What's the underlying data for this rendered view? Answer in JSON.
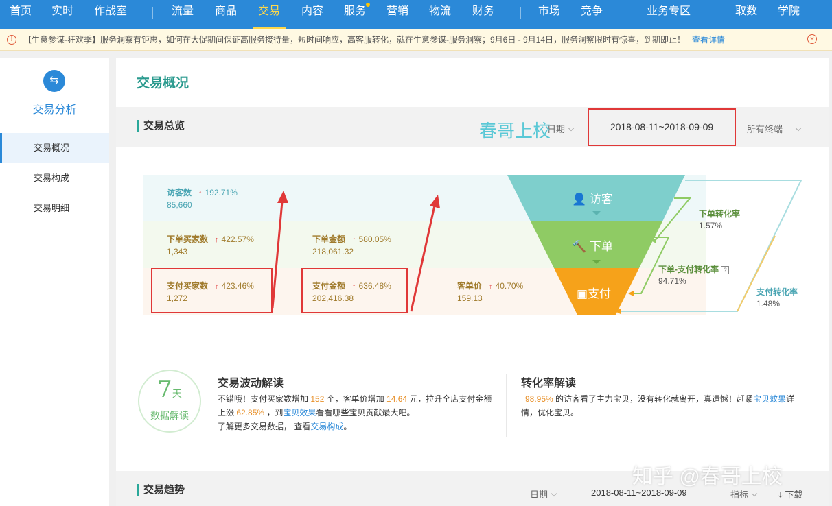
{
  "top_nav": {
    "items": [
      "首页",
      "实时",
      "作战室",
      "流量",
      "商品",
      "交易",
      "内容",
      "服务",
      "营销",
      "物流",
      "财务",
      "市场",
      "竞争",
      "业务专区",
      "取数",
      "学院"
    ],
    "active": "交易",
    "accent_color": "#2b89d8",
    "active_color": "#ffd84a"
  },
  "notice": {
    "icon": "alert-circle-icon",
    "text": "【生意参谋-狂欢季】服务洞察有钜惠，如何在大促期间保证高服务接待量，短时间响应，高客服转化，就在生意参谋-服务洞察；9月6日 - 9月14日，服务洞察限时有惊喜，到期即止！",
    "link": "查看详情",
    "close_icon": "close-circle-icon"
  },
  "sidebar": {
    "logo_icon": "exchange-icon",
    "title": "交易分析",
    "items": [
      "交易概况",
      "交易构成",
      "交易明细"
    ],
    "active": "交易概况"
  },
  "page_title": "交易概况",
  "overview": {
    "title": "交易总览",
    "date_label": "日期",
    "date_range": "2018-08-11~2018-09-09",
    "terminal": "所有终端",
    "watermark": "春哥上校",
    "metrics": {
      "visitors": {
        "label": "访客数",
        "change": "192.71%",
        "value": "85,660"
      },
      "order_buyers": {
        "label": "下单买家数",
        "change": "422.57%",
        "value": "1,343"
      },
      "order_amount": {
        "label": "下单金额",
        "change": "580.05%",
        "value": "218,061.32"
      },
      "pay_buyers": {
        "label": "支付买家数",
        "change": "423.46%",
        "value": "1,272"
      },
      "pay_amount": {
        "label": "支付金额",
        "change": "636.48%",
        "value": "202,416.38"
      },
      "unit_price": {
        "label": "客单价",
        "change": "40.70%",
        "value": "159.13"
      }
    },
    "funnel": {
      "visitor": "访客",
      "order": "下单",
      "pay": "支付",
      "colors": {
        "visitor": "#7ecfcc",
        "order": "#8fcb64",
        "pay": "#f6a21a"
      }
    },
    "rates": {
      "order_rate": {
        "label": "下单转化率",
        "value": "1.57%"
      },
      "order_pay_rate": {
        "label": "下单-支付转化率",
        "value": "94.71%"
      },
      "pay_rate": {
        "label": "支付转化率",
        "value": "1.48%"
      }
    }
  },
  "reading": {
    "circle_number": "7",
    "circle_unit": "天",
    "circle_label": "数据解读",
    "fluctuation": {
      "title": "交易波动解读",
      "t1": "不错哦！支付买家数增加 ",
      "n1": "152",
      "t2": " 个，客单价增加 ",
      "n2": "14.64",
      "t3": " 元，拉升全店支付金额上涨 ",
      "n3": "62.85%",
      "t4": " ，到",
      "link1": "宝贝效果",
      "t5": "看看哪些宝贝贡献最大吧。",
      "t6": "了解更多交易数据，  查看",
      "link2": "交易构成",
      "t7": "。"
    },
    "conversion": {
      "title": "转化率解读",
      "n1": "98.95%",
      "t1": " 的访客看了主力宝贝，没有转化就离开，真遗憾！赶紧",
      "link1": "宝贝效果",
      "t2": "详情，优化宝贝。"
    }
  },
  "trend": {
    "title": "交易趋势",
    "date_label": "日期",
    "date_range": "2018-08-11~2018-09-09",
    "metric_label": "指标",
    "download": "下载"
  },
  "footer_watermark": "知乎 @春哥上校"
}
